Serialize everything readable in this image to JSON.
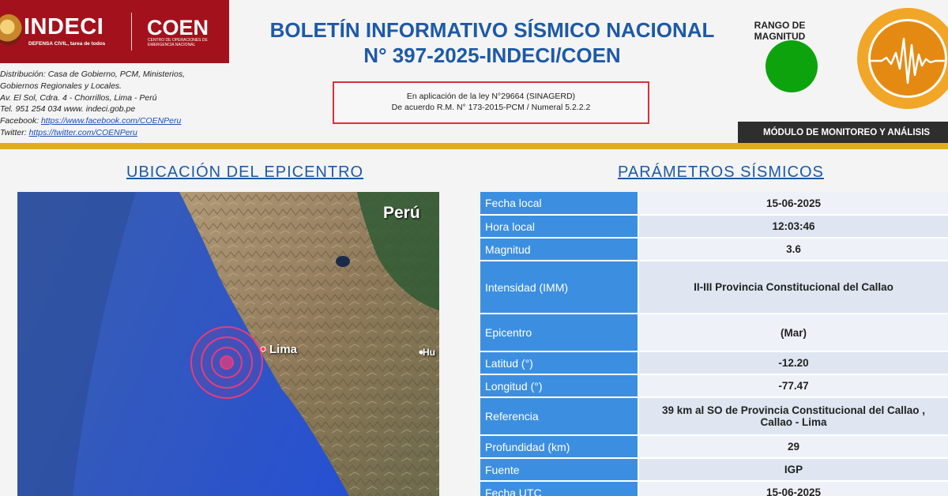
{
  "header": {
    "logo_indeci": "INDECI",
    "logo_indeci_sub": "DEFENSA CIVIL, tarea de todos",
    "logo_coen": "COEN",
    "logo_coen_sub": "CENTRO DE OPERACIONES DE EMERGENCIA NACIONAL",
    "contact_lines": [
      "Distribución: Casa de Gobierno, PCM, Ministerios,",
      "Gobiernos Regionales y Locales.",
      "Av. El Sol, Cdra. 4 - Chorrillos, Lima - Perú",
      "Tel. 951 254 034 www. indeci.gob.pe"
    ],
    "facebook_label": "Facebook:",
    "facebook_link": "https://www.facebook.com/COENPeru",
    "twitter_label": "Twitter:",
    "twitter_link": "https://twitter.com/COENPeru",
    "title_line1": "BOLETÍN INFORMATIVO SÍSMICO NACIONAL",
    "title_line2": "N° 397-2025-INDECI/COEN",
    "law_line1": "En aplicación de la ley N°29664 (SINAGERD)",
    "law_line2": "De acuerdo R.M. N° 173-2015-PCM / Numeral 5.2.2.2",
    "range_label": "RANGO DE MAGNITUD",
    "range_color": "#0da30d",
    "module_label": "MÓDULO DE MONITOREO Y ANÁLISIS",
    "badge_icon": "seismograph-icon"
  },
  "sections": {
    "location_title": "UBICACIÓN DEL EPICENTRO",
    "params_title": "PARÁMETROS SÍSMICOS"
  },
  "map": {
    "country_label": "Perú",
    "city_label": "Lima",
    "partial_city_label": "Hu",
    "epicenter_icon": "epicenter-target-icon"
  },
  "params": {
    "fecha_local": {
      "label": "Fecha local",
      "value": "15-06-2025"
    },
    "hora_local": {
      "label": "Hora local",
      "value": "12:03:46"
    },
    "magnitud": {
      "label": "Magnitud",
      "value": "3.6"
    },
    "intensidad": {
      "label": "Intensidad (IMM)",
      "value": "II-III Provincia Constitucional del Callao"
    },
    "epicentro": {
      "label": "Epicentro",
      "value": "(Mar)"
    },
    "latitud": {
      "label": "Latitud (°)",
      "value": "-12.20"
    },
    "longitud": {
      "label": "Longitud (°)",
      "value": "-77.47"
    },
    "referencia": {
      "label": "Referencia",
      "value_line1": "39 km al SO de Provincia Constitucional del Callao ,",
      "value_line2": "Callao - Lima"
    },
    "profundidad": {
      "label": "Profundidad (km)",
      "value": "29"
    },
    "fuente": {
      "label": "Fuente",
      "value": "IGP"
    },
    "fecha_utc": {
      "label": "Fecha UTC",
      "value": "15-06-2025"
    }
  },
  "colors": {
    "brand_red": "#a3121c",
    "title_blue": "#1d5aa6",
    "label_blue": "#3c8fe0",
    "gold": "#e0ad1e"
  }
}
